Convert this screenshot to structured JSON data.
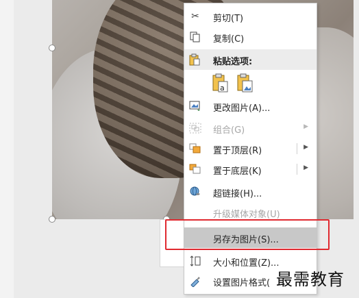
{
  "menu": {
    "cut": "剪切(T)",
    "copy": "复制(C)",
    "paste_options": "粘贴选项:",
    "change_picture": "更改图片(A)...",
    "group": "组合(G)",
    "bring_to_front": "置于顶层(R)",
    "send_to_back": "置于底层(K)",
    "hyperlink": "超链接(H)...",
    "upgrade_media": "升级媒体对象(U)",
    "save_as_picture": "另存为图片(S)...",
    "size_position": "大小和位置(Z)...",
    "format_picture": "设置图片格式("
  },
  "watermark": "最需教育",
  "colors": {
    "highlight_box": "#e0292f",
    "menu_bg": "#ffffff"
  }
}
